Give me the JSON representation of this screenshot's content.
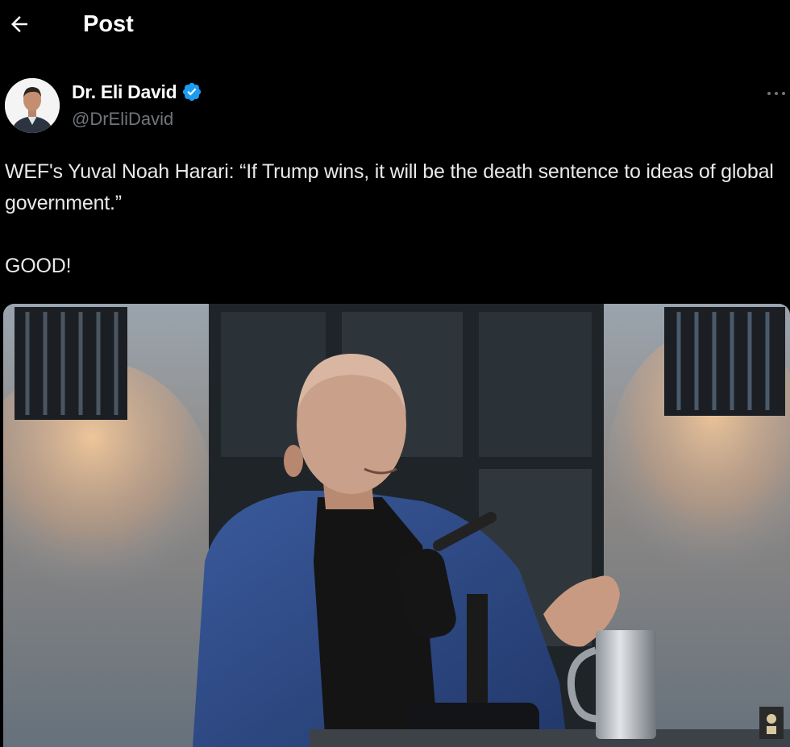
{
  "header": {
    "back_icon": "arrow-left-icon",
    "title": "Post"
  },
  "author": {
    "name": "Dr. Eli David",
    "handle": "@DrEliDavid",
    "verified": true,
    "verified_color": "#1d9bf0",
    "avatar_icon": "user-avatar"
  },
  "post": {
    "text_line1": "WEF's Yuval Noah Harari: “If Trump wins, it will be the death sentence to ideas of global government.”",
    "text_line2": "GOOD!",
    "more_icon": "more-horizontal-icon"
  },
  "colors": {
    "background": "#000000",
    "text_primary": "#e7e9ea",
    "text_secondary": "#71767b",
    "accent": "#1d9bf0"
  }
}
